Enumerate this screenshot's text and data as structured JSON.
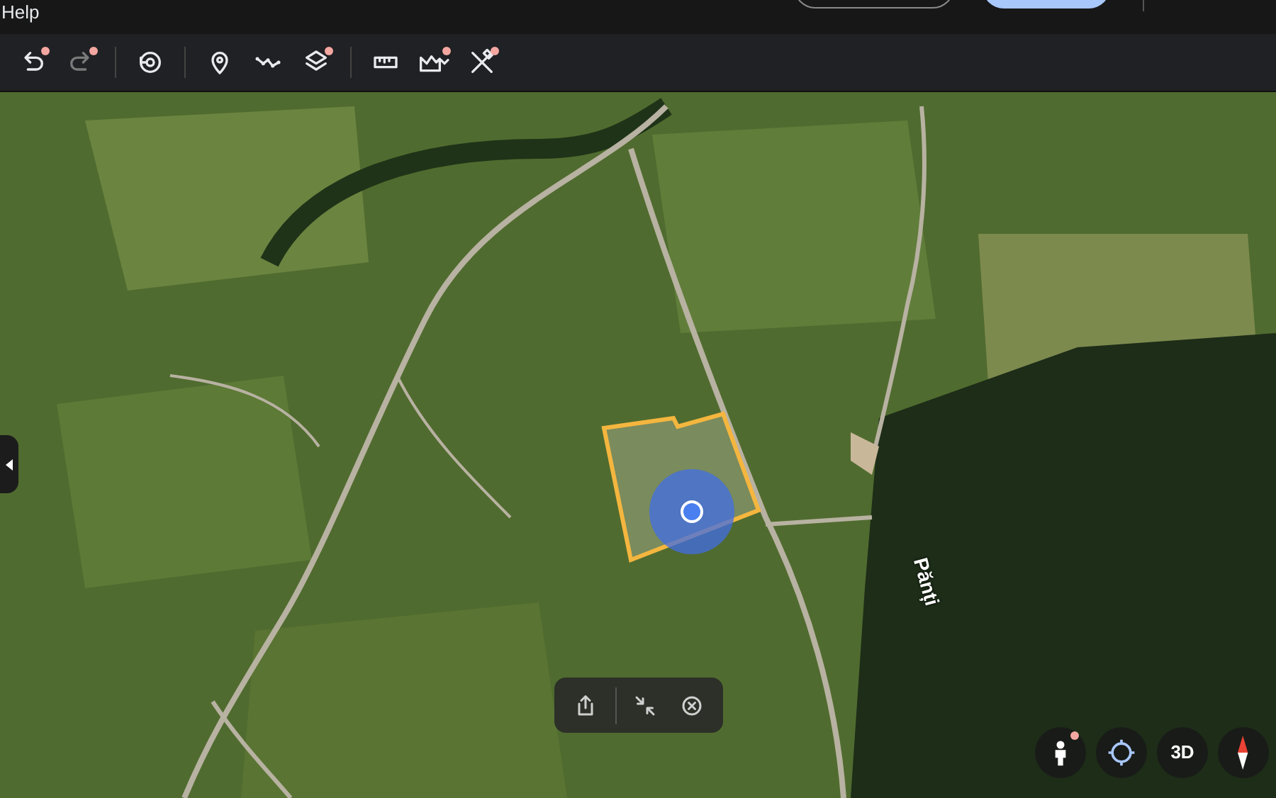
{
  "menu_bar": {
    "items": [
      {
        "label": "Help"
      }
    ]
  },
  "toolbar": {
    "items": [
      {
        "kind": "undo",
        "dot": true,
        "disabled": false
      },
      {
        "kind": "redo",
        "dot": true,
        "disabled": true
      },
      {
        "kind": "separator"
      },
      {
        "kind": "history",
        "dot": false,
        "disabled": false
      },
      {
        "kind": "separator"
      },
      {
        "kind": "pin",
        "dot": false,
        "disabled": false
      },
      {
        "kind": "path",
        "dot": false,
        "disabled": false
      },
      {
        "kind": "layers",
        "dot": true,
        "disabled": false
      },
      {
        "kind": "separator"
      },
      {
        "kind": "ruler",
        "dot": false,
        "disabled": false
      },
      {
        "kind": "terrain",
        "dot": true,
        "disabled": false
      },
      {
        "kind": "tools",
        "dot": true,
        "disabled": false
      }
    ]
  },
  "map": {
    "road_label": "Pănți"
  },
  "bottom_bar": {
    "items": [
      {
        "kind": "share"
      },
      {
        "kind": "separator"
      },
      {
        "kind": "collapse"
      },
      {
        "kind": "close"
      }
    ]
  },
  "map_controls": {
    "items": [
      {
        "kind": "person",
        "dot": true
      },
      {
        "kind": "locate",
        "dot": false
      },
      {
        "kind": "text",
        "label": "3D",
        "dot": false
      },
      {
        "kind": "compass",
        "dot": false
      }
    ]
  }
}
